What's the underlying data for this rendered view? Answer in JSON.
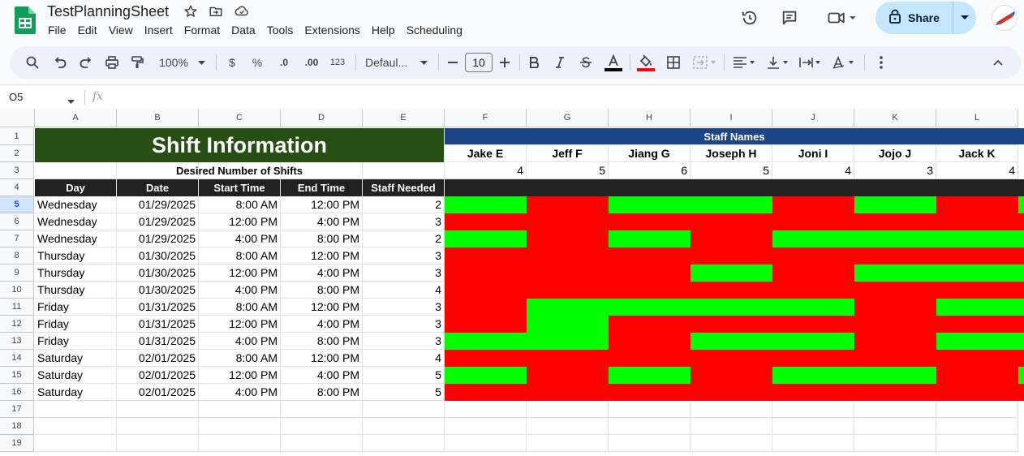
{
  "title": "TestPlanningSheet",
  "menu": [
    "File",
    "Edit",
    "View",
    "Insert",
    "Format",
    "Data",
    "Tools",
    "Extensions",
    "Help",
    "Scheduling"
  ],
  "share_label": "Share",
  "toolbar": {
    "zoom": "100%",
    "currency": "$",
    "percent": "%",
    "dec_decrease": ".0",
    "dec_increase": ".00",
    "number_format": "123",
    "font": "Defaul...",
    "font_size": "10"
  },
  "name_box": "O5",
  "fx_label": "fx",
  "columns": [
    "A",
    "B",
    "C",
    "D",
    "E",
    "F",
    "G",
    "H",
    "I",
    "J",
    "K",
    "L"
  ],
  "rows": [
    "1",
    "2",
    "3",
    "4",
    "5",
    "6",
    "7",
    "8",
    "9",
    "10",
    "11",
    "12",
    "13",
    "14",
    "15",
    "16",
    "17",
    "18",
    "19"
  ],
  "sheet": {
    "shift_info_title": "Shift Information",
    "staff_names_title": "Staff Names",
    "desired_label": "Desired Number of Shifts",
    "headers": [
      "Day",
      "Date",
      "Start Time",
      "End Time",
      "Staff Needed"
    ],
    "staff": [
      {
        "name": "Jake E",
        "desired": "4"
      },
      {
        "name": "Jeff F",
        "desired": "5"
      },
      {
        "name": "Jiang G",
        "desired": "6"
      },
      {
        "name": "Joseph H",
        "desired": "5"
      },
      {
        "name": "Joni I",
        "desired": "4"
      },
      {
        "name": "Jojo J",
        "desired": "3"
      },
      {
        "name": "Jack K",
        "desired": "4"
      }
    ],
    "shifts": [
      {
        "day": "Wednesday",
        "date": "01/29/2025",
        "start": "8:00 AM",
        "end": "12:00 PM",
        "needed": "2",
        "avail": "GRGGRGRG"
      },
      {
        "day": "Wednesday",
        "date": "01/29/2025",
        "start": "12:00 PM",
        "end": "4:00 PM",
        "needed": "3",
        "avail": "RRRRRRRR"
      },
      {
        "day": "Wednesday",
        "date": "01/29/2025",
        "start": "4:00 PM",
        "end": "8:00 PM",
        "needed": "2",
        "avail": "GRGRGGGG"
      },
      {
        "day": "Thursday",
        "date": "01/30/2025",
        "start": "8:00 AM",
        "end": "12:00 PM",
        "needed": "3",
        "avail": "RRRRRRRR"
      },
      {
        "day": "Thursday",
        "date": "01/30/2025",
        "start": "12:00 PM",
        "end": "4:00 PM",
        "needed": "3",
        "avail": "RRRGRGGG"
      },
      {
        "day": "Thursday",
        "date": "01/30/2025",
        "start": "4:00 PM",
        "end": "8:00 PM",
        "needed": "4",
        "avail": "RRRRRRRR"
      },
      {
        "day": "Friday",
        "date": "01/31/2025",
        "start": "8:00 AM",
        "end": "12:00 PM",
        "needed": "3",
        "avail": "RGGGGRGG"
      },
      {
        "day": "Friday",
        "date": "01/31/2025",
        "start": "12:00 PM",
        "end": "4:00 PM",
        "needed": "3",
        "avail": "RGRRRRRR"
      },
      {
        "day": "Friday",
        "date": "01/31/2025",
        "start": "4:00 PM",
        "end": "8:00 PM",
        "needed": "3",
        "avail": "GGRGGRGG"
      },
      {
        "day": "Saturday",
        "date": "02/01/2025",
        "start": "8:00 AM",
        "end": "12:00 PM",
        "needed": "4",
        "avail": "RRRRRRRR"
      },
      {
        "day": "Saturday",
        "date": "02/01/2025",
        "start": "12:00 PM",
        "end": "4:00 PM",
        "needed": "5",
        "avail": "GRGRGGRG"
      },
      {
        "day": "Saturday",
        "date": "02/01/2025",
        "start": "4:00 PM",
        "end": "8:00 PM",
        "needed": "5",
        "avail": "RRRRRRRR"
      }
    ]
  },
  "colors": {
    "available": "#00ff00",
    "unavailable": "#ff0000",
    "shift_header_bg": "#274e13",
    "staff_header_bg": "#1c4587",
    "column_header_bg": "#212121",
    "share_bg": "#c2e7ff"
  }
}
